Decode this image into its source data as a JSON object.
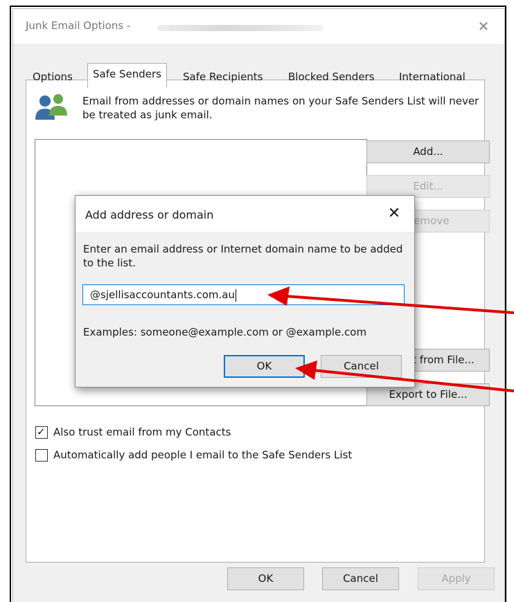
{
  "window": {
    "title": "Junk Email Options -"
  },
  "tabs": [
    {
      "label": "Options"
    },
    {
      "label": "Safe Senders"
    },
    {
      "label": "Safe Recipients"
    },
    {
      "label": "Blocked Senders"
    },
    {
      "label": "International"
    }
  ],
  "description": "Email from addresses or domain names on your Safe Senders List will never be treated as junk email.",
  "side_buttons": {
    "add": "Add...",
    "edit": "Edit...",
    "remove": "Remove",
    "import": "Import from File...",
    "export": "Export to File..."
  },
  "options": {
    "trust_contacts": {
      "label": "Also trust email from my Contacts",
      "checked": true
    },
    "auto_add": {
      "label": "Automatically add people I email to the Safe Senders List",
      "checked": false
    }
  },
  "footer": {
    "ok": "OK",
    "cancel": "Cancel",
    "apply": "Apply"
  },
  "add_dialog": {
    "title": "Add address or domain",
    "prompt": "Enter an email address or Internet domain name to be added to the list.",
    "value": "@sjellisaccountants.com.au",
    "examples": "Examples: someone@example.com or @example.com",
    "ok": "OK",
    "cancel": "Cancel"
  },
  "colors": {
    "focus": "#0078d7",
    "annotation_arrow": "#e00000"
  },
  "icons": {
    "close": "close-icon",
    "people": "people-icon",
    "check": "check-icon",
    "arrow": "arrow-icon"
  }
}
